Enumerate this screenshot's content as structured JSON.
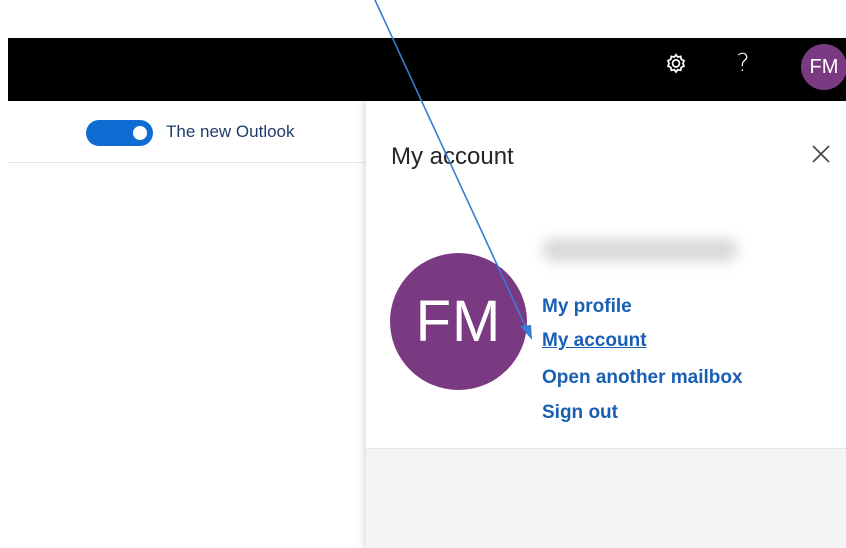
{
  "header": {
    "help_label": "?",
    "avatar_initials": "FM",
    "settings_icon": "gear-icon"
  },
  "toolbar": {
    "toggle_label": "The new Outlook",
    "toggle_on": true
  },
  "panel": {
    "title": "My account",
    "close_icon": "close-icon",
    "avatar_initials": "FM",
    "links": {
      "profile": "My profile",
      "account": "My account",
      "mailbox": "Open another mailbox",
      "signout": "Sign out"
    }
  },
  "colors": {
    "header_bg": "#000000",
    "avatar_bg": "#7a3a82",
    "link": "#1a5fb4",
    "toggle": "#0f6cd2",
    "arrow": "#3a7bd5"
  }
}
